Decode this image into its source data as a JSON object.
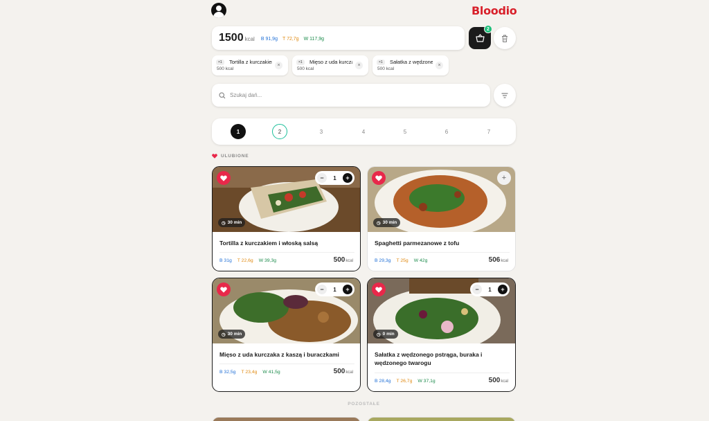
{
  "brand": {
    "logo": "Bloodio"
  },
  "summary": {
    "kcal_value": "1500",
    "kcal_unit": "kcal",
    "protein": "B 91,9g",
    "fat": "T 72,7g",
    "carbs": "W 117,9g",
    "cart_count": "2"
  },
  "chips": [
    {
      "qty": "×1",
      "name": "Tortilla z kurczakiem i włoską salsą",
      "kcal": "500 kcal"
    },
    {
      "qty": "×1",
      "name": "Mięso z uda kurczaka z kaszą i buraczkami",
      "kcal": "500 kcal"
    },
    {
      "qty": "×1",
      "name": "Sałatka z wędzonego pstrąga, buraka i wędzonego twarogu",
      "kcal": "500 kcal"
    }
  ],
  "search": {
    "placeholder": "Szukaj dań..."
  },
  "pagination": {
    "pages": [
      "1",
      "2",
      "3",
      "4",
      "5",
      "6",
      "7"
    ],
    "active": "1"
  },
  "sections": {
    "favorites": "ULUBIONE",
    "others": "POZOSTAŁE"
  },
  "cards": [
    {
      "title": "Tortilla z kurczakiem i włoską salsą",
      "time": "30 min",
      "protein": "B 31g",
      "fat": "T 22,6g",
      "carbs": "W 39,3g",
      "kcal": "500",
      "kcal_unit": "kcal",
      "qty": "1",
      "in_cart": true
    },
    {
      "title": "Spaghetti parmezanowe z tofu",
      "time": "30 min",
      "protein": "B 29,3g",
      "fat": "T 25g",
      "carbs": "W 42g",
      "kcal": "506",
      "kcal_unit": "kcal",
      "in_cart": false
    },
    {
      "title": "Mięso z uda kurczaka z kaszą i buraczkami",
      "time": "30 min",
      "protein": "B 32,5g",
      "fat": "T 23,4g",
      "carbs": "W 41,5g",
      "kcal": "500",
      "kcal_unit": "kcal",
      "qty": "1",
      "in_cart": true
    },
    {
      "title": "Sałatka z wędzonego pstrąga, buraka i wędzonego twarogu",
      "time": "0 min",
      "protein": "B 28,4g",
      "fat": "T 26,7g",
      "carbs": "W 37,1g",
      "kcal": "500",
      "kcal_unit": "kcal",
      "qty": "1",
      "in_cart": true
    }
  ],
  "colors": {
    "accent_red": "#d8202a",
    "heart": "#e8284a",
    "badge_green": "#1bbf7a",
    "protein": "#1f6fd6",
    "fat": "#e08a12",
    "carbs": "#1a8a4a"
  }
}
